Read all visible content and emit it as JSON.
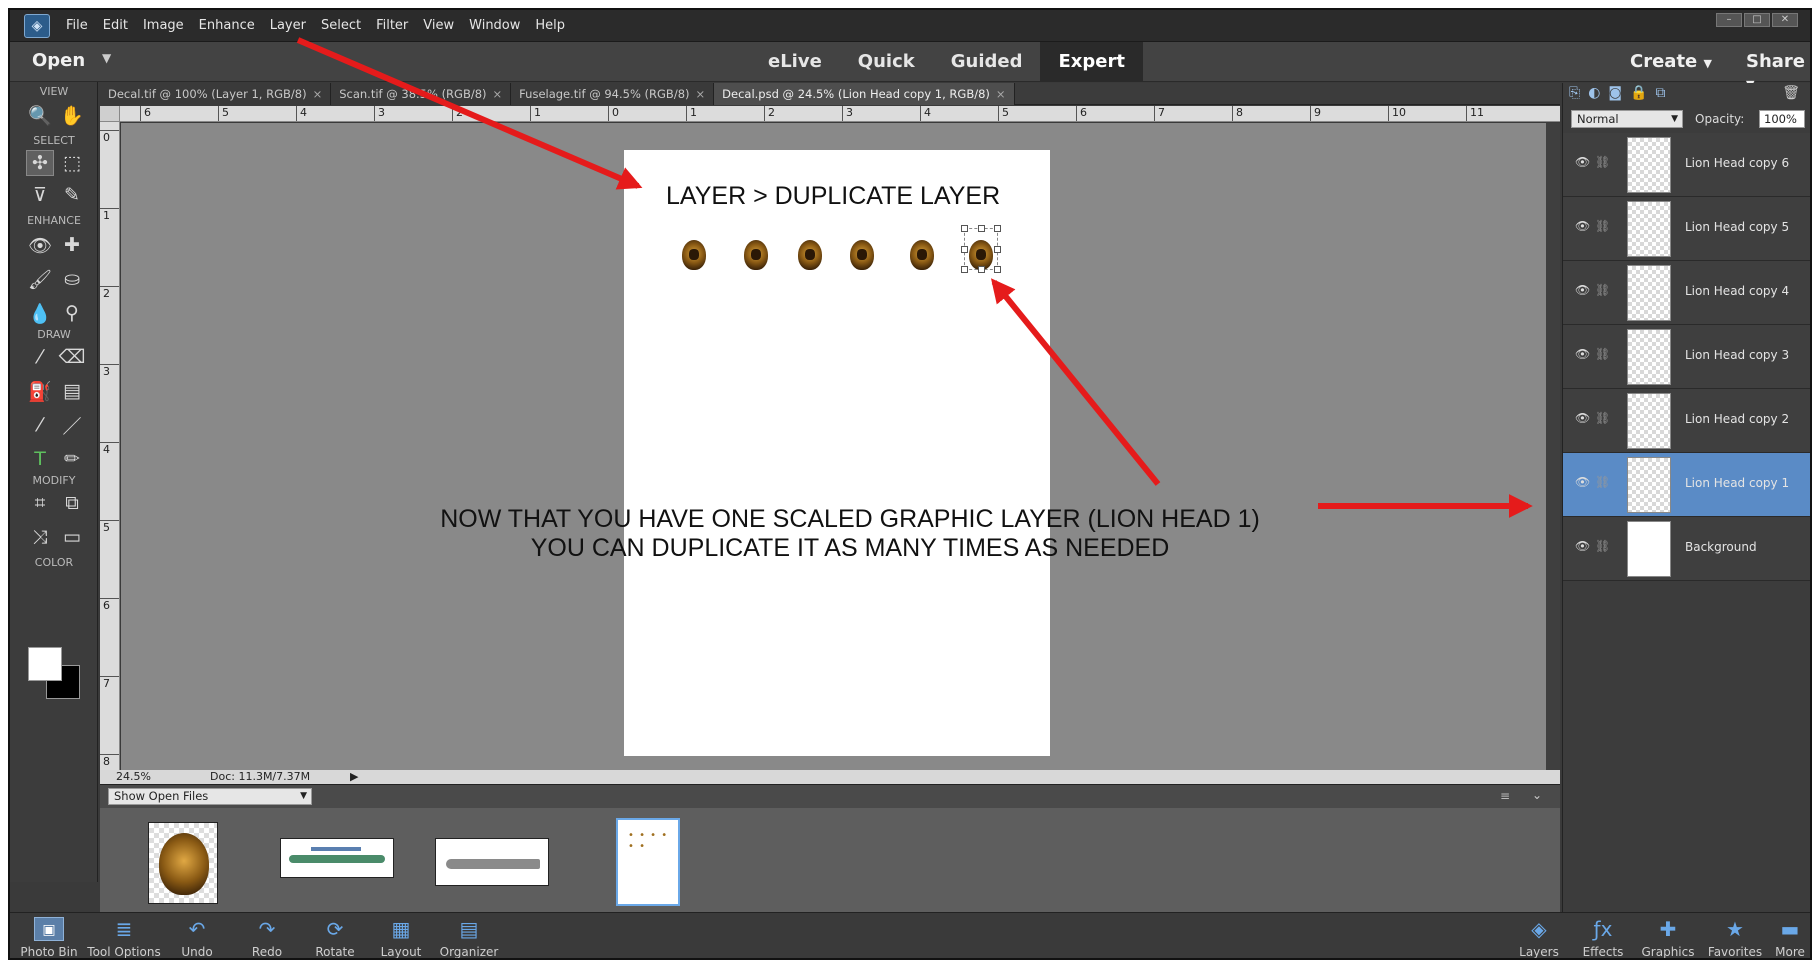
{
  "menubar": {
    "items": [
      "File",
      "Edit",
      "Image",
      "Enhance",
      "Layer",
      "Select",
      "Filter",
      "View",
      "Window",
      "Help"
    ]
  },
  "modebar": {
    "open_label": "Open",
    "modes": [
      "eLive",
      "Quick",
      "Guided",
      "Expert"
    ],
    "active_mode": "Expert",
    "create_label": "Create",
    "share_label": "Share"
  },
  "toolbox": {
    "sections": [
      "VIEW",
      "SELECT",
      "ENHANCE",
      "DRAW",
      "MODIFY",
      "COLOR"
    ]
  },
  "tabs": [
    {
      "label": "Decal.tif @ 100% (Layer 1, RGB/8)"
    },
    {
      "label": "Scan.tif @ 38.5% (RGB/8)"
    },
    {
      "label": "Fuselage.tif @ 94.5% (RGB/8)"
    },
    {
      "label": "Decal.psd @ 24.5% (Lion Head copy 1, RGB/8)"
    }
  ],
  "ruler_h": [
    "6",
    "5",
    "4",
    "3",
    "2",
    "1",
    "0",
    "1",
    "2",
    "3",
    "4",
    "5",
    "6",
    "7",
    "8",
    "9",
    "10",
    "11"
  ],
  "ruler_v": [
    "0",
    "1",
    "2",
    "3",
    "4",
    "5",
    "6",
    "7",
    "8"
  ],
  "annotations": {
    "top": "LAYER > DUPLICATE LAYER",
    "middle_line1": "NOW THAT YOU HAVE ONE SCALED GRAPHIC LAYER  (LION HEAD 1)",
    "middle_line2": "YOU CAN DUPLICATE IT AS MANY TIMES AS NEEDED"
  },
  "status": {
    "zoom": "24.5%",
    "doc": "Doc: 11.3M/7.37M"
  },
  "photo_bin": {
    "show_label": "Show Open Files"
  },
  "taskbar": {
    "left": [
      "Photo Bin",
      "Tool Options",
      "Undo",
      "Redo",
      "Rotate",
      "Layout",
      "Organizer"
    ],
    "right": [
      "Layers",
      "Effects",
      "Graphics",
      "Favorites",
      "More"
    ]
  },
  "layers_panel": {
    "blend_mode": "Normal",
    "opacity_label": "Opacity:",
    "opacity_value": "100%",
    "layers": [
      {
        "name": "Lion Head copy 6",
        "selected": false
      },
      {
        "name": "Lion Head copy 5",
        "selected": false
      },
      {
        "name": "Lion Head copy 4",
        "selected": false
      },
      {
        "name": "Lion Head copy 3",
        "selected": false
      },
      {
        "name": "Lion Head copy 2",
        "selected": false
      },
      {
        "name": "Lion Head copy 1",
        "selected": true
      },
      {
        "name": "Background",
        "selected": false
      }
    ]
  },
  "colors": {
    "arrow": "#e51b1b",
    "selected_layer": "#5a8bc6",
    "canvas_bg": "#898989",
    "workspace_bg": "#3a3a3a"
  }
}
